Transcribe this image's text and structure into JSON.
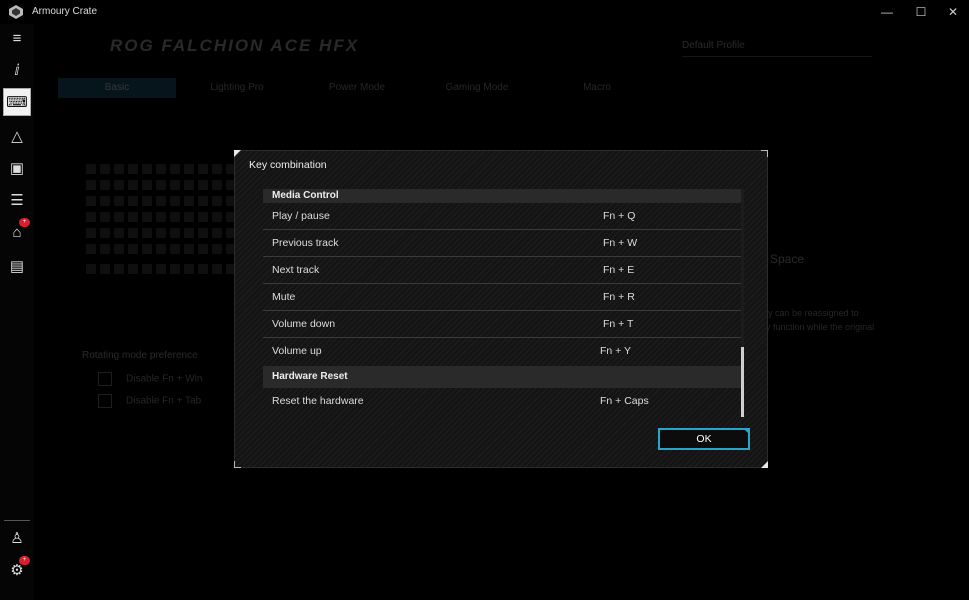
{
  "window": {
    "title": "Armoury Crate",
    "controls": [
      "—",
      "☐",
      "✕"
    ]
  },
  "sidebar": {
    "items": [
      {
        "icon": "menu-icon",
        "glyph": "≡"
      },
      {
        "icon": "info-icon",
        "glyph": "ⅈ"
      },
      {
        "icon": "keyboard-icon",
        "glyph": "⌨",
        "active": true
      },
      {
        "icon": "aura-icon",
        "glyph": "△"
      },
      {
        "icon": "game-library-icon",
        "glyph": "▣"
      },
      {
        "icon": "settings-sliders-icon",
        "glyph": "☰"
      },
      {
        "icon": "deals-tag-icon",
        "glyph": "⌂",
        "badge": "+"
      },
      {
        "icon": "news-icon",
        "glyph": "▤"
      }
    ],
    "bottom": [
      {
        "icon": "user-icon",
        "glyph": "♙"
      },
      {
        "icon": "settings-gear-icon",
        "glyph": "⚙",
        "badge": "+"
      }
    ]
  },
  "background": {
    "device_title": "ROG FALCHION ACE HFX",
    "profile": "Default Profile",
    "tabs": [
      "Basic",
      "Lighting Pro",
      "Power Mode",
      "Gaming Mode",
      "Macro"
    ],
    "pref_title": "Rotating mode preference",
    "pref_options": [
      "Disable Fn + Win",
      "Disable Fn + Tab"
    ],
    "space_label": "Space",
    "desc": "When enabled, a key can be reassigned to perform a secondary function while the original key still works."
  },
  "modal": {
    "title": "Key combination",
    "sections": [
      {
        "name": "Media Control",
        "rows": [
          {
            "action": "Play / pause",
            "combo": "Fn + Q"
          },
          {
            "action": "Previous track",
            "combo": "Fn + W"
          },
          {
            "action": "Next track",
            "combo": "Fn + E"
          },
          {
            "action": "Mute",
            "combo": "Fn + R"
          },
          {
            "action": "Volume down",
            "combo": "Fn + T"
          },
          {
            "action": "Volume up",
            "combo": "Fn + Y"
          }
        ]
      },
      {
        "name": "Hardware Reset",
        "rows": [
          {
            "action": "Reset the hardware",
            "combo": "Fn + Caps"
          }
        ]
      }
    ],
    "ok_label": "OK",
    "accent": "#27a6c9"
  }
}
